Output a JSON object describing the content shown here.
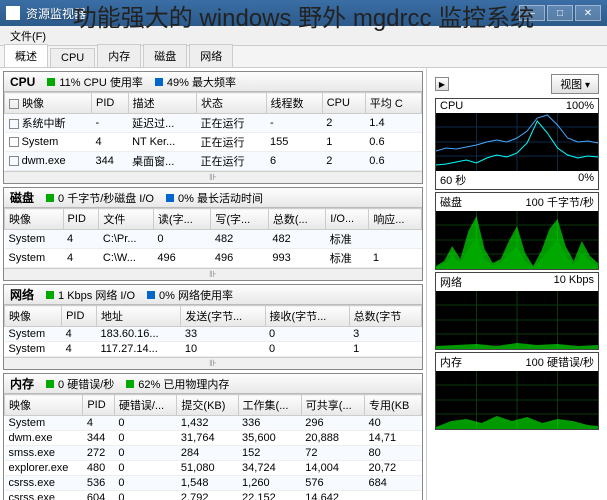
{
  "overlay_title": "功能强大的 windows 野外 mgdrcc 监控系统",
  "window": {
    "title": "资源监视器"
  },
  "menu": {
    "file": "文件(F)"
  },
  "tabs": [
    "概述",
    "CPU",
    "内存",
    "磁盘",
    "网络"
  ],
  "panels": {
    "cpu": {
      "title": "CPU",
      "stat1": "11% CPU 使用率",
      "stat2": "49% 最大频率",
      "cols": [
        "映像",
        "PID",
        "描述",
        "状态",
        "线程数",
        "CPU",
        "平均 C"
      ],
      "rows": [
        {
          "img": "系统中断",
          "pid": "-",
          "desc": "延迟过...",
          "status": "正在运行",
          "threads": "-",
          "cpu": "2",
          "avg": "1.4"
        },
        {
          "img": "System",
          "pid": "4",
          "desc": "NT Ker...",
          "status": "正在运行",
          "threads": "155",
          "cpu": "1",
          "avg": "0.6"
        },
        {
          "img": "dwm.exe",
          "pid": "344",
          "desc": "桌面窗...",
          "status": "正在运行",
          "threads": "6",
          "cpu": "2",
          "avg": "0.6"
        }
      ]
    },
    "disk": {
      "title": "磁盘",
      "stat1": "0 千字节/秒磁盘 I/O",
      "stat2": "0% 最长活动时间",
      "cols": [
        "映像",
        "PID",
        "文件",
        "读(字...",
        "写(字...",
        "总数(...",
        "I/O...",
        "响应..."
      ],
      "rows": [
        {
          "img": "System",
          "pid": "4",
          "file": "C:\\Pr...",
          "r": "0",
          "w": "482",
          "t": "482",
          "io": "标准",
          "resp": ""
        },
        {
          "img": "System",
          "pid": "4",
          "file": "C:\\W...",
          "r": "496",
          "w": "496",
          "t": "993",
          "io": "标准",
          "resp": "1"
        }
      ]
    },
    "net": {
      "title": "网络",
      "stat1": "1 Kbps 网络 I/O",
      "stat2": "0% 网络使用率",
      "cols": [
        "映像",
        "PID",
        "地址",
        "发送(字节...",
        "接收(字节...",
        "总数(字节"
      ],
      "rows": [
        {
          "img": "System",
          "pid": "4",
          "addr": "183.60.16...",
          "s": "33",
          "r": "0",
          "t": "3"
        },
        {
          "img": "System",
          "pid": "4",
          "addr": "117.27.14...",
          "s": "10",
          "r": "0",
          "t": "1"
        }
      ]
    },
    "mem": {
      "title": "内存",
      "stat1": "0 硬错误/秒",
      "stat2": "62% 已用物理内存",
      "cols": [
        "映像",
        "PID",
        "硬错误/...",
        "提交(KB)",
        "工作集(...",
        "可共享(...",
        "专用(KB"
      ],
      "rows": [
        {
          "img": "System",
          "pid": "4",
          "hf": "0",
          "commit": "1,432",
          "ws": "336",
          "sh": "296",
          "priv": "40"
        },
        {
          "img": "dwm.exe",
          "pid": "344",
          "hf": "0",
          "commit": "31,764",
          "ws": "35,600",
          "sh": "20,888",
          "priv": "14,71"
        },
        {
          "img": "smss.exe",
          "pid": "272",
          "hf": "0",
          "commit": "284",
          "ws": "152",
          "sh": "72",
          "priv": "80"
        },
        {
          "img": "explorer.exe",
          "pid": "480",
          "hf": "0",
          "commit": "51,080",
          "ws": "34,724",
          "sh": "14,004",
          "priv": "20,72"
        },
        {
          "img": "csrss.exe",
          "pid": "536",
          "hf": "0",
          "commit": "1,548",
          "ws": "1,260",
          "sh": "576",
          "priv": "684"
        },
        {
          "img": "csrss.exe",
          "pid": "604",
          "hf": "0",
          "commit": "2,792",
          "ws": "22,152",
          "sh": "14,642",
          "priv": ""
        }
      ]
    }
  },
  "right": {
    "view_btn": "视图",
    "cpu": {
      "title": "CPU",
      "val": "100%",
      "btm_l": "60 秒",
      "btm_r": "0%"
    },
    "disk": {
      "title": "磁盘",
      "val": "100 千字节/秒"
    },
    "net": {
      "title": "网络",
      "val": "10 Kbps"
    },
    "mem": {
      "title": "内存",
      "val": "100 硬错误/秒"
    }
  },
  "chart_data": {
    "type": "line",
    "charts": [
      {
        "name": "CPU",
        "series": [
          {
            "name": "usage",
            "values": [
              10,
              12,
              15,
              20,
              18,
              25,
              40,
              35,
              32,
              28,
              22,
              20,
              15,
              18,
              22,
              30,
              50,
              80,
              95,
              70,
              40,
              30,
              24,
              25,
              30,
              35,
              30,
              28,
              26,
              24
            ]
          },
          {
            "name": "freq",
            "values": [
              35,
              40,
              38,
              42,
              45,
              50,
              55,
              50,
              48,
              45,
              42,
              45,
              50,
              55,
              60,
              70,
              85,
              98,
              100,
              80,
              60,
              50,
              48,
              50,
              52,
              55,
              50,
              48,
              46,
              44
            ]
          }
        ]
      },
      {
        "name": "disk",
        "values": [
          0,
          5,
          15,
          40,
          20,
          8,
          30,
          60,
          95,
          40,
          10,
          5,
          2,
          8,
          25,
          50,
          30,
          12,
          5,
          20,
          45,
          70,
          35,
          15,
          8,
          30,
          55,
          25,
          10,
          5
        ]
      },
      {
        "name": "net",
        "values": [
          2,
          3,
          2,
          4,
          3,
          5,
          4,
          3,
          2,
          3,
          4,
          5,
          4,
          3,
          2,
          3,
          4,
          3,
          2,
          3,
          4,
          5,
          4,
          3,
          2,
          3,
          4,
          3,
          2,
          3
        ]
      },
      {
        "name": "mem",
        "values": [
          0,
          2,
          5,
          10,
          8,
          3,
          6,
          12,
          8,
          4,
          2,
          5,
          9,
          6,
          3,
          7,
          11,
          7,
          4,
          2,
          6,
          10,
          7,
          3,
          5,
          9,
          6,
          3,
          2,
          4
        ]
      }
    ]
  }
}
